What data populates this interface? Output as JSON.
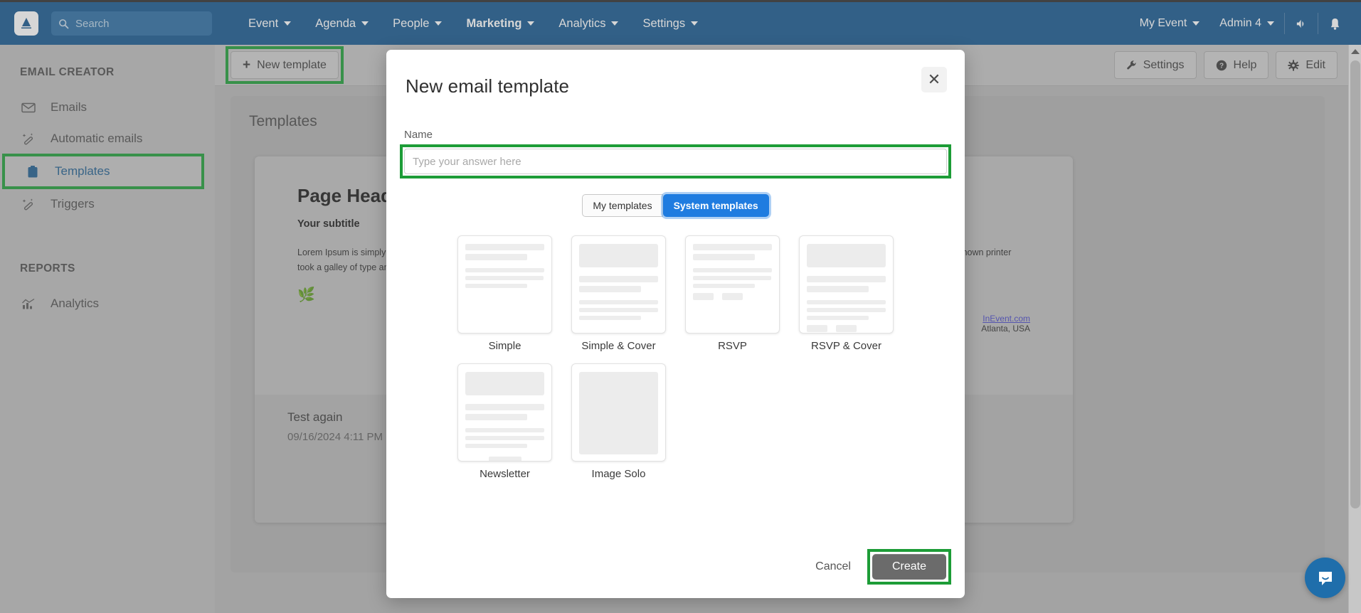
{
  "topnav": {
    "logo": "inevent-logo",
    "search": {
      "placeholder": "Search",
      "value": ""
    },
    "items": [
      {
        "label": "Event",
        "icon": "chevron-down-icon",
        "active": false
      },
      {
        "label": "Agenda",
        "icon": "chevron-down-icon",
        "active": false
      },
      {
        "label": "People",
        "icon": "chevron-down-icon",
        "active": false
      },
      {
        "label": "Marketing",
        "icon": "chevron-down-icon",
        "active": true
      },
      {
        "label": "Analytics",
        "icon": "chevron-down-icon",
        "active": false
      },
      {
        "label": "Settings",
        "icon": "chevron-down-icon",
        "active": false
      }
    ],
    "right": [
      {
        "label": "My Event",
        "icon": "chevron-down-icon"
      },
      {
        "label": "Admin 4",
        "icon": "chevron-down-icon"
      }
    ],
    "announce_icon": "megaphone-icon",
    "bell_icon": "bell-icon"
  },
  "sidebar": {
    "sections": [
      {
        "title": "EMAIL CREATOR",
        "items": [
          {
            "label": "Emails",
            "icon": "envelope-icon",
            "selected": false
          },
          {
            "label": "Automatic emails",
            "icon": "magic-wand-icon",
            "selected": false
          },
          {
            "label": "Templates",
            "icon": "clipboard-icon",
            "selected": true,
            "highlighted": true
          },
          {
            "label": "Triggers",
            "icon": "magic-wand-icon",
            "selected": false
          }
        ]
      },
      {
        "title": "REPORTS",
        "items": [
          {
            "label": "Analytics",
            "icon": "bar-chart-icon",
            "selected": false
          }
        ]
      }
    ]
  },
  "toolbar": {
    "new_template_label": "New template",
    "new_template_icon": "plus-icon",
    "new_template_highlighted": true,
    "right_buttons": [
      {
        "label": "Settings",
        "icon": "wrench-icon"
      },
      {
        "label": "Help",
        "icon": "question-circle-icon"
      },
      {
        "label": "Edit",
        "icon": "gear-icon"
      }
    ]
  },
  "content": {
    "pane_title": "Templates",
    "template_card": {
      "heading": "Page Header",
      "subtitle": "Your subtitle",
      "body": "Lorem Ipsum is simply dummy text of the printing and typesetting industry. Lorem Ipsum has been the industry's standard dummy text ever since the 1500s, when an unknown printer took a galley of type and scrambled it to make a type specimen book.",
      "emoji": "bouquet-image",
      "footer_link": "InEvent.com",
      "footer_location": "Atlanta, USA",
      "name": "Test again",
      "date": "09/16/2024 4:11 PM"
    }
  },
  "modal": {
    "title": "New email template",
    "close_icon": "close-icon",
    "name_label": "Name",
    "name_placeholder": "Type your answer here",
    "name_value": "",
    "name_highlighted": true,
    "tabs": [
      {
        "label": "My templates",
        "active": false
      },
      {
        "label": "System templates",
        "active": true
      }
    ],
    "templates": [
      {
        "label": "Simple",
        "layout": "simple"
      },
      {
        "label": "Simple & Cover",
        "layout": "simple-cover"
      },
      {
        "label": "RSVP",
        "layout": "rsvp"
      },
      {
        "label": "RSVP & Cover",
        "layout": "rsvp-cover"
      },
      {
        "label": "Newsletter",
        "layout": "newsletter"
      },
      {
        "label": "Image Solo",
        "layout": "image-solo"
      }
    ],
    "cancel_label": "Cancel",
    "create_label": "Create",
    "create_highlighted": true
  },
  "intercom": {
    "icon": "chat-bubble-icon"
  },
  "colors": {
    "nav_blue": "#15578f",
    "accent_blue": "#1f7ce0",
    "highlight_green": "#1d9c37",
    "create_gray": "#6b6b6b",
    "sidebar_gray": "#bcbcbc"
  }
}
